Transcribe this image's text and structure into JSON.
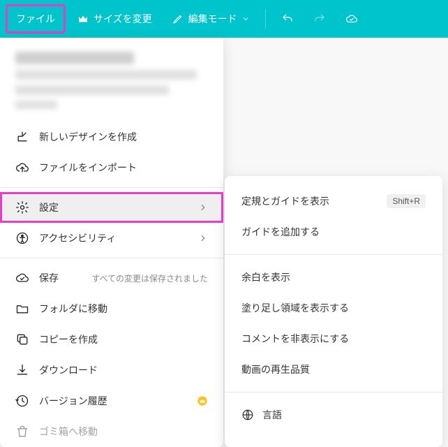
{
  "toolbar": {
    "file": "ファイル",
    "resize": "サイズを変更",
    "edit_mode": "編集モード"
  },
  "menu": {
    "create": "新しいデザインを作成",
    "import": "ファイルをインポート",
    "settings": "設定",
    "accessibility": "アクセシビリティ",
    "save": "保存",
    "save_status": "すべての変更は保存されました",
    "move_folder": "フォルダに移動",
    "copy": "コピーを作成",
    "download": "ダウンロード",
    "version": "バージョン履歴",
    "trash": "ゴミ箱へ移動"
  },
  "submenu": {
    "show_rulers": "定規とガイドを表示",
    "show_rulers_kbd": "Shift+R",
    "add_guide": "ガイドを追加する",
    "show_margin": "余白を表示",
    "show_bleed": "塗り足し領域を表示する",
    "hide_comments": "コメントを非表示にする",
    "video_quality": "動画の再生品質",
    "language": "言語"
  }
}
